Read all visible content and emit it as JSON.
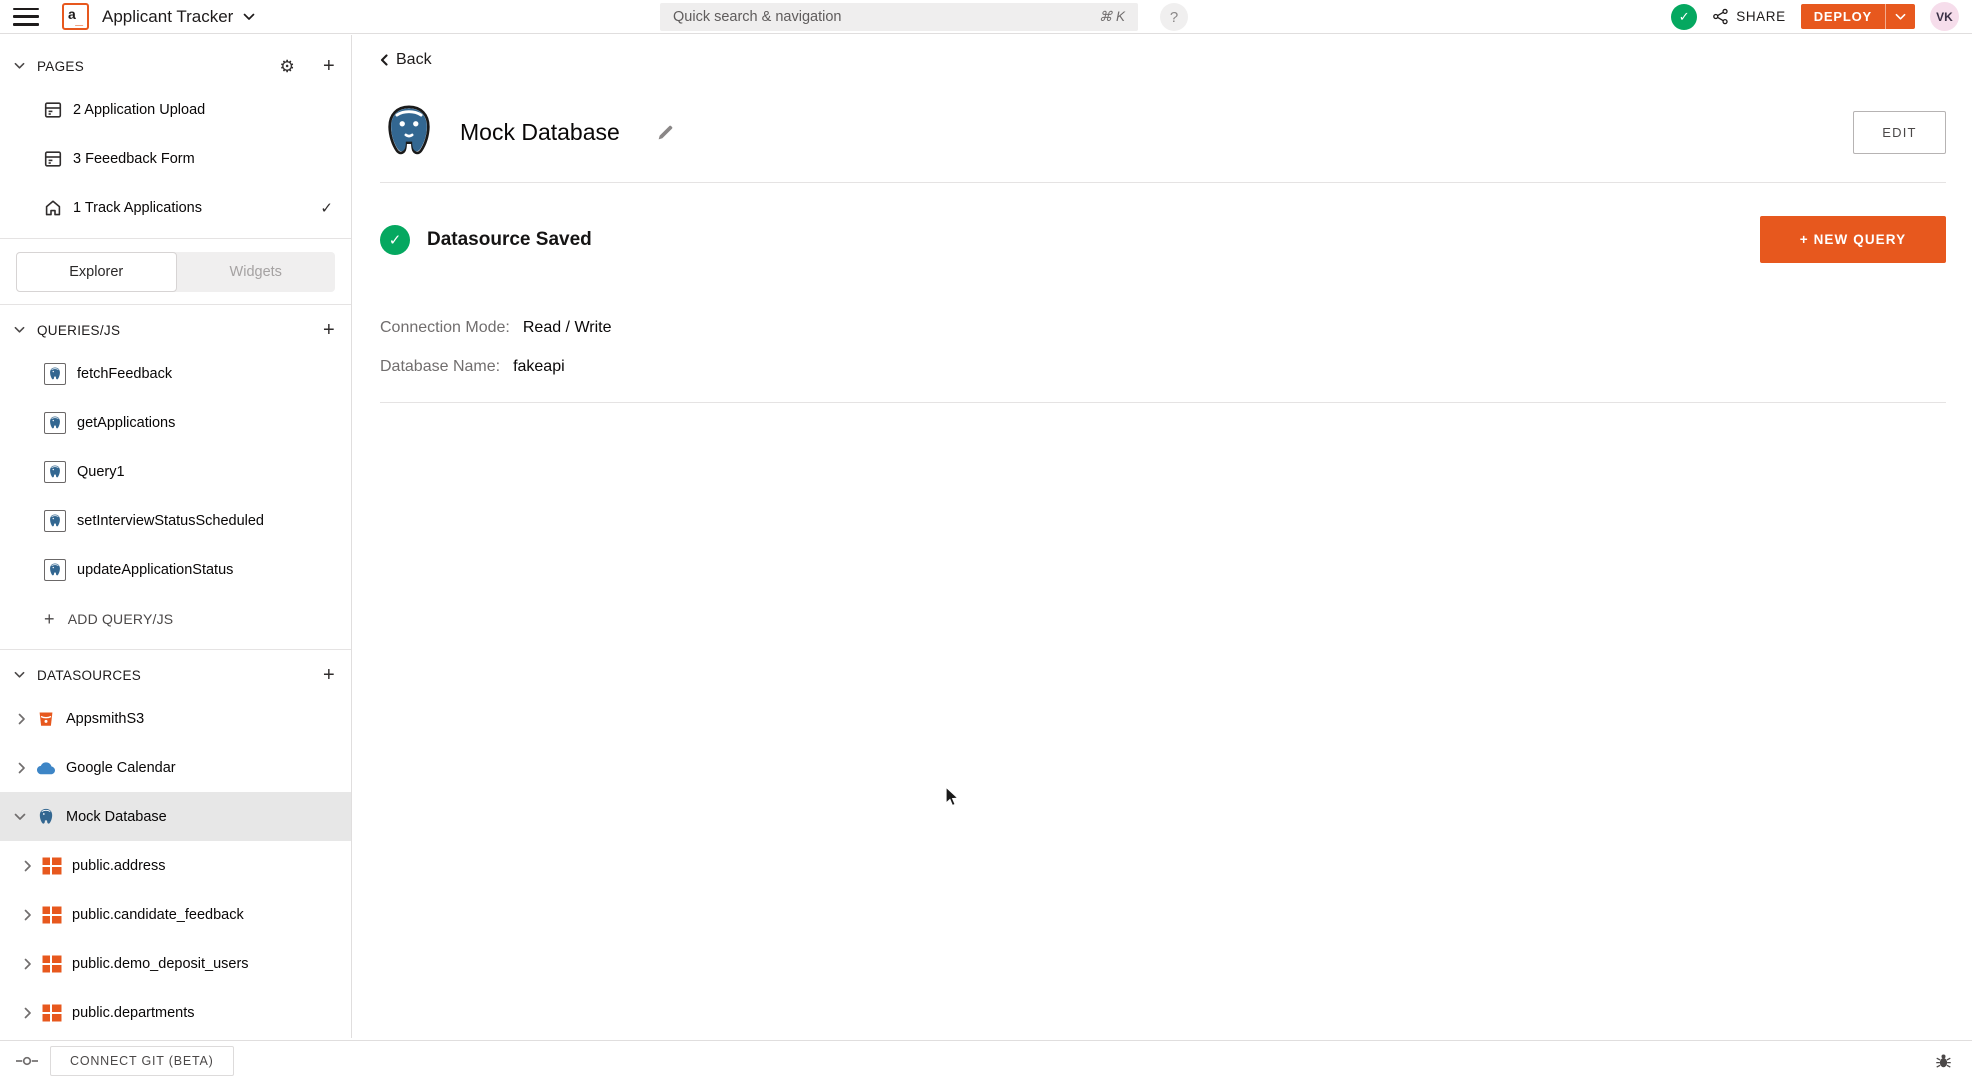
{
  "colors": {
    "accent": "#E7581E",
    "success": "#05A860",
    "postgres_blue": "#336791",
    "calendar_blue": "#3D85C6",
    "avatar_bg": "#F6DDEB",
    "selected_row_bg": "#E7E7E7"
  },
  "topbar": {
    "app_title": "Applicant Tracker",
    "search_placeholder": "Quick search & navigation",
    "search_shortcut": "⌘ K",
    "help_label": "?",
    "save_check": "✓",
    "share_label": "SHARE",
    "deploy_label": "DEPLOY",
    "avatar_initials": "VK"
  },
  "sidebar": {
    "pages": {
      "header": "PAGES",
      "items": [
        {
          "label": "2 Application Upload",
          "icon": "page-icon"
        },
        {
          "label": "3 Feeedback Form",
          "icon": "page-icon"
        },
        {
          "label": "1 Track Applications",
          "icon": "home-icon",
          "check": "✓"
        }
      ]
    },
    "tabs": {
      "explorer": "Explorer",
      "widgets": "Widgets"
    },
    "queries": {
      "header": "QUERIES/JS",
      "items": [
        "fetchFeedback",
        "getApplications",
        "Query1",
        "setInterviewStatusScheduled",
        "updateApplicationStatus"
      ],
      "add_label": "ADD QUERY/JS"
    },
    "datasources": {
      "header": "DATASOURCES",
      "items": [
        {
          "label": "AppsmithS3",
          "icon": "s3-icon"
        },
        {
          "label": "Google Calendar",
          "icon": "calendar-cloud-icon"
        },
        {
          "label": "Mock Database",
          "icon": "postgres-icon",
          "selected": true
        }
      ],
      "tables": [
        "public.address",
        "public.candidate_feedback",
        "public.demo_deposit_users",
        "public.departments"
      ]
    }
  },
  "main": {
    "back_label": "Back",
    "title": "Mock Database",
    "edit_button_label": "EDIT",
    "status_text": "Datasource Saved",
    "status_check": "✓",
    "new_query_label": "+ NEW QUERY",
    "fields": [
      {
        "label": "Connection Mode:",
        "value": "Read / Write"
      },
      {
        "label": "Database Name:",
        "value": "fakeapi"
      }
    ]
  },
  "footer": {
    "connect_git_label": "CONNECT GIT (BETA)"
  }
}
